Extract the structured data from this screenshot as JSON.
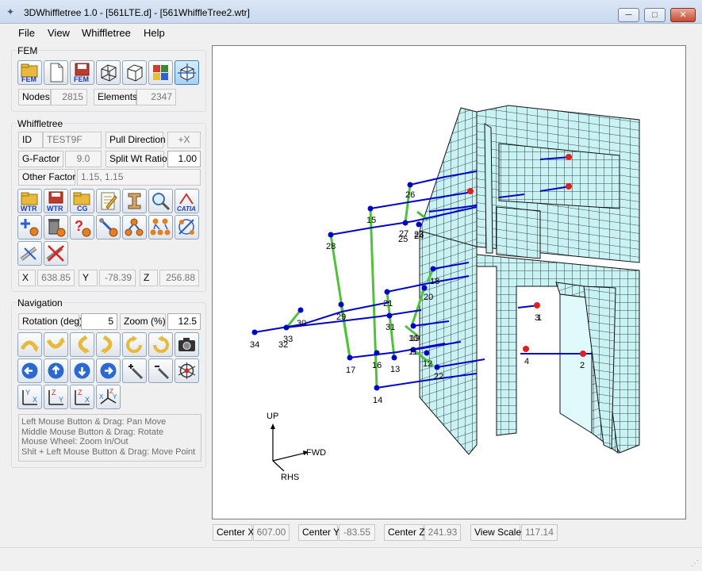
{
  "window": {
    "title": "3DWhiffletree 1.0 - [561LTE.d] - [561WhiffleTree2.wtr]",
    "min_label": "─",
    "max_label": "□",
    "close_label": "✕"
  },
  "menu": {
    "file": "File",
    "view": "View",
    "whiffletree": "Whiffletree",
    "help": "Help"
  },
  "fem": {
    "group_label": "FEM",
    "nodes_label": "Nodes",
    "nodes_value": "2815",
    "elements_label": "Elements",
    "elements_value": "2347",
    "toolbar": [
      {
        "icon": "open-fem-icon",
        "text": "FEM"
      },
      {
        "icon": "new-document-icon",
        "text": ""
      },
      {
        "icon": "save-fem-icon",
        "text": "FEM"
      },
      {
        "icon": "wireframe-cube-icon",
        "text": ""
      },
      {
        "icon": "solid-cube-icon",
        "text": ""
      },
      {
        "icon": "color-grid-icon",
        "text": ""
      },
      {
        "icon": "shaded-cube-icon",
        "text": ""
      }
    ]
  },
  "whiffletree": {
    "group_label": "Whiffletree",
    "id_label": "ID",
    "id_value": "TEST9F",
    "pull_direction_label": "Pull Direction",
    "pull_direction_value": "+X",
    "gfactor_label": "G-Factor",
    "gfactor_value": "9.0",
    "split_ratio_label": "Split Wt Ratio",
    "split_ratio_value": "1.00",
    "other_factor_label": "Other Factor",
    "other_factor_value": "1.15, 1.15",
    "toolbar_row1_texts": [
      "WTR",
      "WTR",
      "CG",
      "",
      "",
      "",
      "CATIA"
    ],
    "x_label": "X",
    "x_value": "638.85",
    "y_label": "Y",
    "y_value": "-78.39",
    "z_label": "Z",
    "z_value": "256.88"
  },
  "navigation": {
    "group_label": "Navigation",
    "rotation_label": "Rotation (deg)",
    "rotation_value": "5",
    "zoom_label": "Zoom (%)",
    "zoom_value": "12.5",
    "hints": [
      "Left Mouse Button & Drag: Pan Move",
      "Middle Mouse Button & Drag: Rotate",
      "Mouse Wheel: Zoom In/Out",
      "Shit + Left Mouse Button & Drag: Move Point"
    ]
  },
  "viewport": {
    "axis_up": "UP",
    "axis_fwd": "FWD",
    "axis_rhs": "RHS",
    "mesh_color": "#c9f2f4",
    "line_color": "#0000c8",
    "link_color": "#4fc23a",
    "load_color": "#e02020",
    "node_labels": [
      "1",
      "2",
      "3",
      "4",
      "10",
      "11",
      "12",
      "13",
      "14",
      "15",
      "16",
      "17",
      "18",
      "19",
      "20",
      "21",
      "22",
      "23",
      "24",
      "25",
      "26",
      "27",
      "28",
      "29",
      "30",
      "31",
      "32",
      "33",
      "34"
    ]
  },
  "status": {
    "center_x_label": "Center X",
    "center_x_value": "607.00",
    "center_y_label": "Center Y",
    "center_y_value": "-83.55",
    "center_z_label": "Center Z",
    "center_z_value": "241.93",
    "view_scale_label": "View Scale",
    "view_scale_value": "117.14"
  }
}
